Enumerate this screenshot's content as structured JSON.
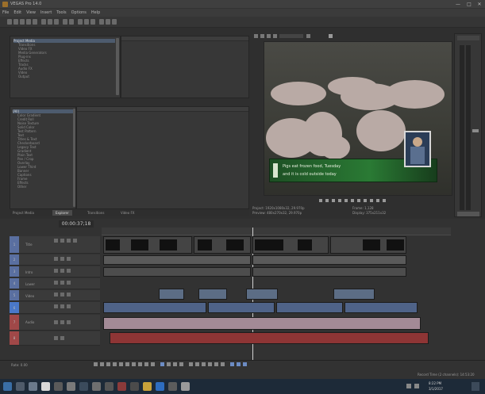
{
  "window": {
    "title": "VEGAS Pro 14.0",
    "controls": [
      "—",
      "□",
      "✕"
    ]
  },
  "menu": [
    "File",
    "Edit",
    "View",
    "Insert",
    "Tools",
    "Options",
    "Help"
  ],
  "explorer": {
    "header": "",
    "items": [
      "Project Media",
      "Transitions",
      "Video FX",
      "Media Generators",
      "Plug-ins",
      "Effects",
      "Tracks",
      "Audio FX",
      "Video",
      "Output"
    ]
  },
  "fx_panel": {
    "header": "",
    "items": [
      "(All)",
      "Color Gradient",
      "Credit Roll",
      "Noise Texture",
      "Solid Color",
      "Test Pattern",
      "Text",
      "Titles & Text",
      "Checkerboard",
      "Legacy Text",
      "Gradient",
      "Plain Text",
      "Pan / Crop",
      "Overlay",
      "Lower Third",
      "Banner",
      "Captions",
      "Frame",
      "Effects",
      "Other"
    ]
  },
  "tabs": [
    "Project Media",
    "Explorer",
    "Transitions",
    "Video FX"
  ],
  "preview": {
    "ticker_line1": "Pigs eat frozen food, Tuesday",
    "ticker_line2": "and it is cold outside today",
    "project_info": "Project: 1920x1080x32, 29.970p",
    "preview_info": "Preview: 480x270x32, 29.970p",
    "frame_info": "Frame: 1,128",
    "display_info": "Display: 375x211x32"
  },
  "timeline": {
    "timecode": "00:00:37;18",
    "tracks": [
      {
        "num": "1",
        "name": "Title"
      },
      {
        "num": "2",
        "name": ""
      },
      {
        "num": "3",
        "name": "Intro"
      },
      {
        "num": "4",
        "name": "Lower"
      },
      {
        "num": "5",
        "name": "Video"
      },
      {
        "num": "6",
        "name": ""
      },
      {
        "num": "7",
        "name": "Audio"
      },
      {
        "num": "8",
        "name": ""
      }
    ],
    "rate_label": "Rate: 0.00",
    "record_time": "Record Time (2 channels): 14:53:20"
  },
  "taskbar": {
    "clock_time": "8:22 PM",
    "clock_date": "3/1/2017"
  },
  "colors": {
    "video_clip": "#5c6d85",
    "audio_clip_red": "#b23a3a",
    "ticker_green": "#2a7a34",
    "taskbar": "#1d2a38"
  }
}
